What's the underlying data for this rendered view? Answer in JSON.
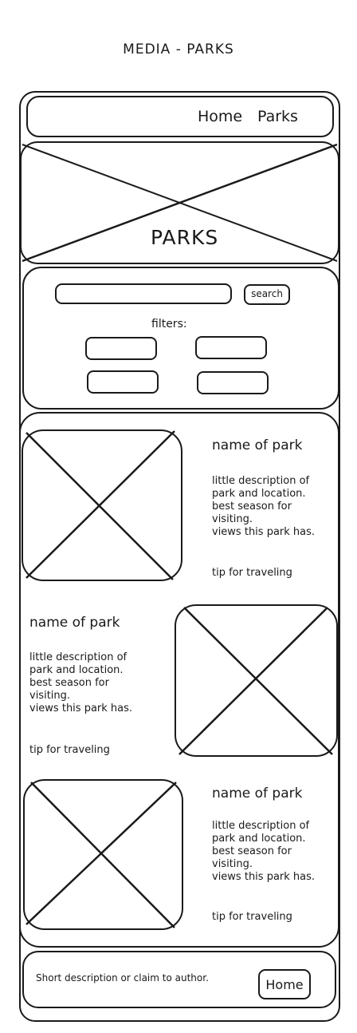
{
  "page_title": "MEDIA - PARKS",
  "nav": {
    "home_label": "Home",
    "parks_label": "Parks"
  },
  "hero": {
    "title": "PARKS"
  },
  "search": {
    "button_label": "search",
    "filters_label": "filters:"
  },
  "parks": [
    {
      "name": "name of park",
      "desc_lines": [
        "little description of",
        "park and location.",
        "best season for",
        "visiting.",
        "views this park has."
      ],
      "tip": "tip for traveling"
    },
    {
      "name": "name of park",
      "desc_lines": [
        "little description of",
        "park and location.",
        "best season for",
        "visiting.",
        "views this park has."
      ],
      "tip": "tip for traveling"
    },
    {
      "name": "name of park",
      "desc_lines": [
        "little description of",
        "park and location.",
        "best season for",
        "visiting.",
        "views this park has."
      ],
      "tip": "tip for traveling"
    }
  ],
  "footer": {
    "text": "Short description or claim to author.",
    "home_label": "Home"
  },
  "colors": {
    "ink": "#1a1a1a",
    "background": "#ffffff"
  },
  "icons": {
    "image_placeholder": "image-placeholder-icon"
  }
}
